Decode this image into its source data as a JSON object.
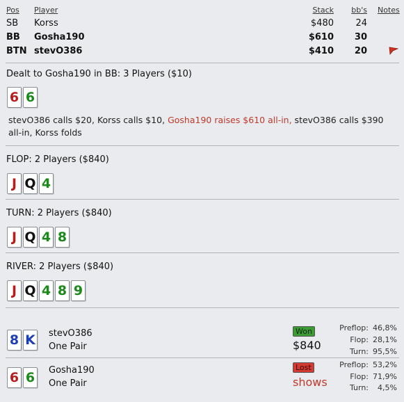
{
  "table": {
    "headers": {
      "pos": "Pos",
      "player": "Player",
      "stack": "Stack",
      "bbs": "bb's",
      "notes": "Notes"
    },
    "rows": [
      {
        "pos": "SB",
        "player": "Korss",
        "stack": "$480",
        "bbs": "24",
        "bold": false,
        "note": false
      },
      {
        "pos": "BB",
        "player": "Gosha190",
        "stack": "$610",
        "bbs": "30",
        "bold": true,
        "note": false
      },
      {
        "pos": "BTN",
        "player": "stevO386",
        "stack": "$410",
        "bbs": "20",
        "bold": true,
        "note": true
      }
    ]
  },
  "preflop": {
    "title": "Dealt to Gosha190 in BB: 3 Players ($10)",
    "cards": [
      {
        "rank": "6",
        "color": "red"
      },
      {
        "rank": "6",
        "color": "green"
      }
    ],
    "action_part1": "stevO386 calls $20, Korss calls $10, ",
    "action_raise": "Gosha190 raises $610 all-in,",
    "action_part2": " stevO386 calls $390 all-in, Korss folds"
  },
  "flop": {
    "title": "FLOP: 2 Players ($840)",
    "cards": [
      {
        "rank": "J",
        "color": "red"
      },
      {
        "rank": "Q",
        "color": "black"
      },
      {
        "rank": "4",
        "color": "green"
      }
    ]
  },
  "turn": {
    "title": "TURN: 2 Players ($840)",
    "cards": [
      {
        "rank": "J",
        "color": "red"
      },
      {
        "rank": "Q",
        "color": "black"
      },
      {
        "rank": "4",
        "color": "green"
      },
      {
        "rank": "8",
        "color": "green"
      }
    ]
  },
  "river": {
    "title": "RIVER: 2 Players ($840)",
    "cards": [
      {
        "rank": "J",
        "color": "red"
      },
      {
        "rank": "Q",
        "color": "black"
      },
      {
        "rank": "4",
        "color": "green"
      },
      {
        "rank": "8",
        "color": "green"
      },
      {
        "rank": "9",
        "color": "green"
      }
    ]
  },
  "showdown": [
    {
      "player": "stevO386",
      "hand": "One Pair",
      "cards": [
        {
          "rank": "8",
          "color": "blue"
        },
        {
          "rank": "K",
          "color": "blue"
        }
      ],
      "result_badge": "Won",
      "result_text": "$840",
      "preflop_label": "Preflop:",
      "preflop": "46,8%",
      "flop_label": "Flop:",
      "flop": "28,1%",
      "turn_label": "Turn:",
      "turn": "95,5%"
    },
    {
      "player": "Gosha190",
      "hand": "One Pair",
      "cards": [
        {
          "rank": "6",
          "color": "red"
        },
        {
          "rank": "6",
          "color": "green"
        }
      ],
      "result_badge": "Lost",
      "result_text": "shows",
      "preflop_label": "Preflop:",
      "preflop": "53,2%",
      "flop_label": "Flop:",
      "flop": "71,9%",
      "turn_label": "Turn:",
      "turn": "4,5%"
    }
  ],
  "colors": {
    "red": "#b71d1d",
    "green": "#1b8a1b",
    "black": "#111111",
    "blue": "#1c3fb3",
    "raise_text": "#c0392b",
    "won_badge": "#3d9b35",
    "lost_badge": "#d33a32"
  }
}
